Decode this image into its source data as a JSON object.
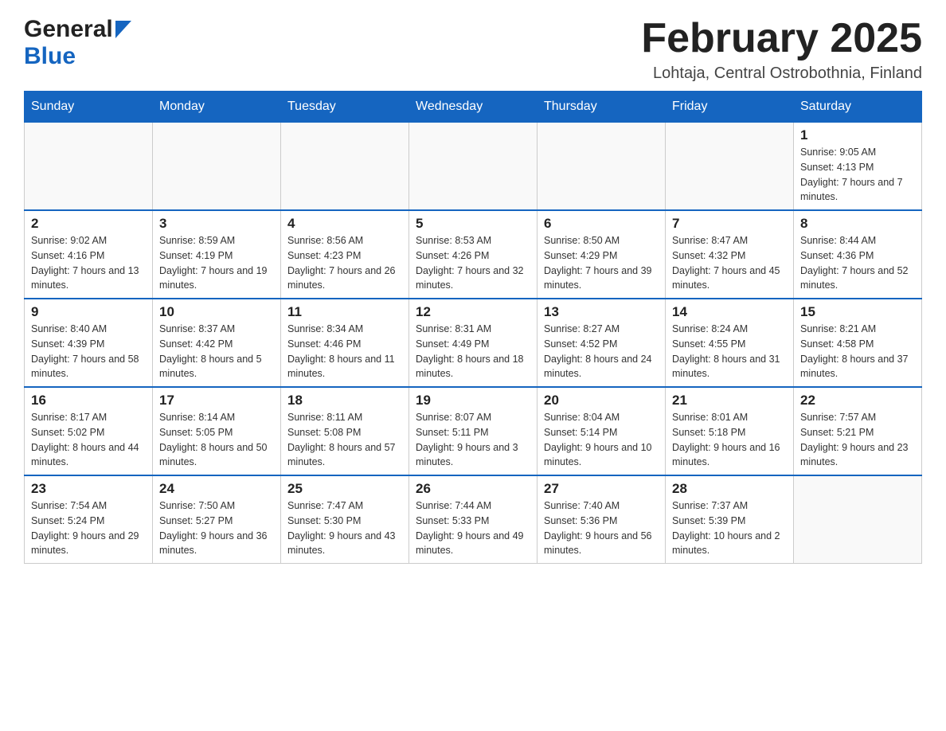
{
  "header": {
    "logo_general": "General",
    "logo_blue": "Blue",
    "month_title": "February 2025",
    "location": "Lohtaja, Central Ostrobothnia, Finland"
  },
  "weekdays": [
    "Sunday",
    "Monday",
    "Tuesday",
    "Wednesday",
    "Thursday",
    "Friday",
    "Saturday"
  ],
  "weeks": [
    {
      "days": [
        {
          "date": "",
          "info": ""
        },
        {
          "date": "",
          "info": ""
        },
        {
          "date": "",
          "info": ""
        },
        {
          "date": "",
          "info": ""
        },
        {
          "date": "",
          "info": ""
        },
        {
          "date": "",
          "info": ""
        },
        {
          "date": "1",
          "info": "Sunrise: 9:05 AM\nSunset: 4:13 PM\nDaylight: 7 hours and 7 minutes."
        }
      ]
    },
    {
      "days": [
        {
          "date": "2",
          "info": "Sunrise: 9:02 AM\nSunset: 4:16 PM\nDaylight: 7 hours and 13 minutes."
        },
        {
          "date": "3",
          "info": "Sunrise: 8:59 AM\nSunset: 4:19 PM\nDaylight: 7 hours and 19 minutes."
        },
        {
          "date": "4",
          "info": "Sunrise: 8:56 AM\nSunset: 4:23 PM\nDaylight: 7 hours and 26 minutes."
        },
        {
          "date": "5",
          "info": "Sunrise: 8:53 AM\nSunset: 4:26 PM\nDaylight: 7 hours and 32 minutes."
        },
        {
          "date": "6",
          "info": "Sunrise: 8:50 AM\nSunset: 4:29 PM\nDaylight: 7 hours and 39 minutes."
        },
        {
          "date": "7",
          "info": "Sunrise: 8:47 AM\nSunset: 4:32 PM\nDaylight: 7 hours and 45 minutes."
        },
        {
          "date": "8",
          "info": "Sunrise: 8:44 AM\nSunset: 4:36 PM\nDaylight: 7 hours and 52 minutes."
        }
      ]
    },
    {
      "days": [
        {
          "date": "9",
          "info": "Sunrise: 8:40 AM\nSunset: 4:39 PM\nDaylight: 7 hours and 58 minutes."
        },
        {
          "date": "10",
          "info": "Sunrise: 8:37 AM\nSunset: 4:42 PM\nDaylight: 8 hours and 5 minutes."
        },
        {
          "date": "11",
          "info": "Sunrise: 8:34 AM\nSunset: 4:46 PM\nDaylight: 8 hours and 11 minutes."
        },
        {
          "date": "12",
          "info": "Sunrise: 8:31 AM\nSunset: 4:49 PM\nDaylight: 8 hours and 18 minutes."
        },
        {
          "date": "13",
          "info": "Sunrise: 8:27 AM\nSunset: 4:52 PM\nDaylight: 8 hours and 24 minutes."
        },
        {
          "date": "14",
          "info": "Sunrise: 8:24 AM\nSunset: 4:55 PM\nDaylight: 8 hours and 31 minutes."
        },
        {
          "date": "15",
          "info": "Sunrise: 8:21 AM\nSunset: 4:58 PM\nDaylight: 8 hours and 37 minutes."
        }
      ]
    },
    {
      "days": [
        {
          "date": "16",
          "info": "Sunrise: 8:17 AM\nSunset: 5:02 PM\nDaylight: 8 hours and 44 minutes."
        },
        {
          "date": "17",
          "info": "Sunrise: 8:14 AM\nSunset: 5:05 PM\nDaylight: 8 hours and 50 minutes."
        },
        {
          "date": "18",
          "info": "Sunrise: 8:11 AM\nSunset: 5:08 PM\nDaylight: 8 hours and 57 minutes."
        },
        {
          "date": "19",
          "info": "Sunrise: 8:07 AM\nSunset: 5:11 PM\nDaylight: 9 hours and 3 minutes."
        },
        {
          "date": "20",
          "info": "Sunrise: 8:04 AM\nSunset: 5:14 PM\nDaylight: 9 hours and 10 minutes."
        },
        {
          "date": "21",
          "info": "Sunrise: 8:01 AM\nSunset: 5:18 PM\nDaylight: 9 hours and 16 minutes."
        },
        {
          "date": "22",
          "info": "Sunrise: 7:57 AM\nSunset: 5:21 PM\nDaylight: 9 hours and 23 minutes."
        }
      ]
    },
    {
      "days": [
        {
          "date": "23",
          "info": "Sunrise: 7:54 AM\nSunset: 5:24 PM\nDaylight: 9 hours and 29 minutes."
        },
        {
          "date": "24",
          "info": "Sunrise: 7:50 AM\nSunset: 5:27 PM\nDaylight: 9 hours and 36 minutes."
        },
        {
          "date": "25",
          "info": "Sunrise: 7:47 AM\nSunset: 5:30 PM\nDaylight: 9 hours and 43 minutes."
        },
        {
          "date": "26",
          "info": "Sunrise: 7:44 AM\nSunset: 5:33 PM\nDaylight: 9 hours and 49 minutes."
        },
        {
          "date": "27",
          "info": "Sunrise: 7:40 AM\nSunset: 5:36 PM\nDaylight: 9 hours and 56 minutes."
        },
        {
          "date": "28",
          "info": "Sunrise: 7:37 AM\nSunset: 5:39 PM\nDaylight: 10 hours and 2 minutes."
        },
        {
          "date": "",
          "info": ""
        }
      ]
    }
  ]
}
